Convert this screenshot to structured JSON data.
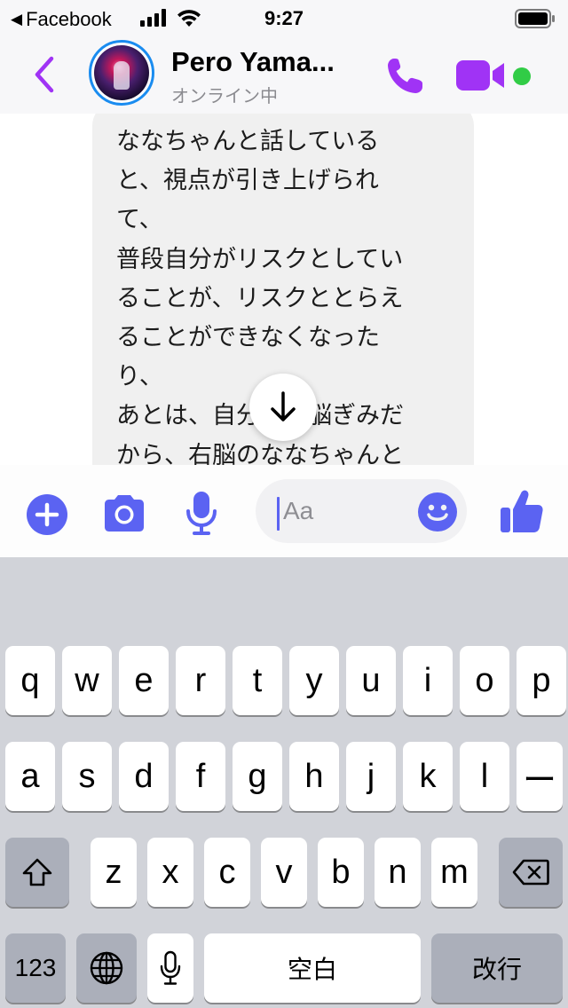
{
  "status_bar": {
    "back_app": "Facebook",
    "time": "9:27",
    "icons": [
      "signal-icon",
      "wifi-icon",
      "battery-icon"
    ]
  },
  "header": {
    "contact_name": "Pero Yama...",
    "contact_status": "オンライン中",
    "online_color": "#31cc46",
    "accent_color": "#a033f5",
    "icons": [
      "back-chevron-icon",
      "phone-icon",
      "video-camera-icon"
    ]
  },
  "chat": {
    "message_text": "ななちゃんと話している\nと、視点が引き上げられ\nて、\n普段自分がリスクとしてい\nることが、リスクととらえ\nることができなくなった\nり、\nあとは、自分が左脳ぎみだ\nから、右脳のななちゃんと",
    "scroll_icon": "arrow-down-icon"
  },
  "composer": {
    "placeholder": "Aa",
    "accent_color": "#5b63f2",
    "icons": [
      "plus-icon",
      "camera-icon",
      "microphone-icon",
      "emoji-icon",
      "thumbs-up-icon"
    ]
  },
  "keyboard": {
    "row1": [
      "q",
      "w",
      "e",
      "r",
      "t",
      "y",
      "u",
      "i",
      "o",
      "p"
    ],
    "row2": [
      "a",
      "s",
      "d",
      "f",
      "g",
      "h",
      "j",
      "k",
      "l",
      "ー"
    ],
    "row3": [
      "z",
      "x",
      "c",
      "v",
      "b",
      "n",
      "m"
    ],
    "numbers_key": "123",
    "space_key": "空白",
    "return_key": "改行"
  }
}
